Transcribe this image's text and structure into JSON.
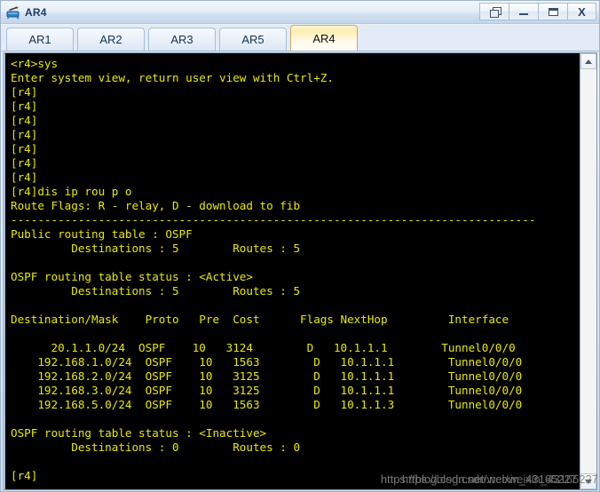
{
  "window": {
    "title": "AR4",
    "icon": "router-icon",
    "controls": [
      {
        "name": "restore-button",
        "label": "❐",
        "glyph": "restore-icon"
      },
      {
        "name": "minimize-button",
        "label": "—",
        "glyph": "minimize-icon"
      },
      {
        "name": "maximize-button",
        "label": "▭",
        "glyph": "maximize-icon"
      },
      {
        "name": "close-button",
        "label": "X",
        "glyph": "close-icon"
      }
    ]
  },
  "tabs": [
    {
      "label": "AR1",
      "active": false
    },
    {
      "label": "AR2",
      "active": false
    },
    {
      "label": "AR3",
      "active": false
    },
    {
      "label": "AR5",
      "active": false
    },
    {
      "label": "AR4",
      "active": true
    }
  ],
  "terminal": {
    "foreground": "#e8e800",
    "background": "#000000",
    "prompt_user": "<r4>",
    "prompt_system": "[r4]",
    "commands": [
      "sys",
      "dis ip rou p o"
    ],
    "content": "<r4>sys\nEnter system view, return user view with Ctrl+Z.\n[r4]\n[r4]\n[r4]\n[r4]\n[r4]\n[r4]\n[r4]\n[r4]dis ip rou p o\nRoute Flags: R - relay, D - download to fib\n------------------------------------------------------------------------------\nPublic routing table : OSPF\n         Destinations : 5        Routes : 5\n\nOSPF routing table status : <Active>\n         Destinations : 5        Routes : 5\n\nDestination/Mask    Proto   Pre  Cost      Flags NextHop         Interface\n\n      20.1.1.0/24  OSPF    10   3124        D   10.1.1.1        Tunnel0/0/0\n    192.168.1.0/24  OSPF    10   1563        D   10.1.1.1        Tunnel0/0/0\n    192.168.2.0/24  OSPF    10   3125        D   10.1.1.1        Tunnel0/0/0\n    192.168.3.0/24  OSPF    10   3125        D   10.1.1.1        Tunnel0/0/0\n    192.168.5.0/24  OSPF    10   1563        D   10.1.1.3        Tunnel0/0/0\n\nOSPF routing table status : <Inactive>\n         Destinations : 0        Routes : 0\n\n[r4]",
    "route_flags_legend": "Route Flags: R - relay, D - download to fib",
    "separator": "------------------------------------------------------------------------------",
    "public_table": {
      "title": "Public routing table : OSPF",
      "destinations_label": "Destinations :",
      "destinations": "5",
      "routes_label": "Routes :",
      "routes": "5"
    },
    "active_table": {
      "title": "OSPF routing table status : <Active>",
      "destinations": "5",
      "routes": "5"
    },
    "inactive_table": {
      "title": "OSPF routing table status : <Inactive>",
      "destinations": "0",
      "routes": "0"
    },
    "route_table": {
      "columns": [
        "Destination/Mask",
        "Proto",
        "Pre",
        "Cost",
        "Flags",
        "NextHop",
        "Interface"
      ],
      "rows": [
        {
          "destination": "20.1.1.0/24",
          "proto": "OSPF",
          "pre": "10",
          "cost": "3124",
          "flags": "D",
          "nexthop": "10.1.1.1",
          "interface": "Tunnel0/0/0"
        },
        {
          "destination": "192.168.1.0/24",
          "proto": "OSPF",
          "pre": "10",
          "cost": "1563",
          "flags": "D",
          "nexthop": "10.1.1.1",
          "interface": "Tunnel0/0/0"
        },
        {
          "destination": "192.168.2.0/24",
          "proto": "OSPF",
          "pre": "10",
          "cost": "3125",
          "flags": "D",
          "nexthop": "10.1.1.1",
          "interface": "Tunnel0/0/0"
        },
        {
          "destination": "192.168.3.0/24",
          "proto": "OSPF",
          "pre": "10",
          "cost": "3125",
          "flags": "D",
          "nexthop": "10.1.1.1",
          "interface": "Tunnel0/0/0"
        },
        {
          "destination": "192.168.5.0/24",
          "proto": "OSPF",
          "pre": "10",
          "cost": "1563",
          "flags": "D",
          "nexthop": "10.1.1.3",
          "interface": "Tunnel0/0/0"
        }
      ]
    }
  },
  "scrollbar": {
    "up_arrow": "scroll-up-icon",
    "down_arrow": "scroll-down-icon"
  },
  "watermark": {
    "line1": "https://blog.csdn.net/weixin_43165227",
    "line2": "https://blog.csdn.net/weixin_43165227"
  }
}
